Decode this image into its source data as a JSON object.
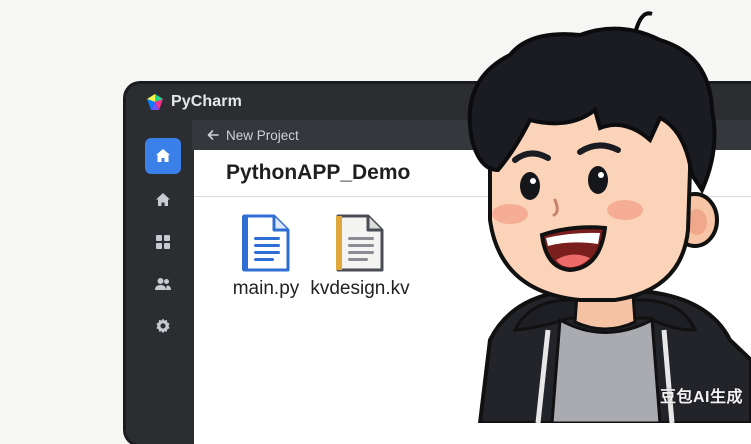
{
  "app": {
    "title": "PyCharm"
  },
  "topbar": {
    "back_label": "New Project"
  },
  "project": {
    "name": "PythonAPP_Demo"
  },
  "files": [
    {
      "name": "main.py",
      "icon": "python-file-icon"
    },
    {
      "name": "kvdesign.kv",
      "icon": "kv-file-icon"
    }
  ],
  "sidebar": {
    "items": [
      {
        "icon": "home-icon",
        "active": true
      },
      {
        "icon": "home-outline-icon",
        "active": false
      },
      {
        "icon": "grid-icon",
        "active": false
      },
      {
        "icon": "users-icon",
        "active": false
      },
      {
        "icon": "gear-icon",
        "active": false
      }
    ]
  },
  "watermark": "豆包AI生成",
  "colors": {
    "accent": "#3a80e8",
    "window_bg": "#2b2d30",
    "content_bg": "#ffffff",
    "hoodie": "#23242a",
    "hair": "#1a1c22"
  }
}
